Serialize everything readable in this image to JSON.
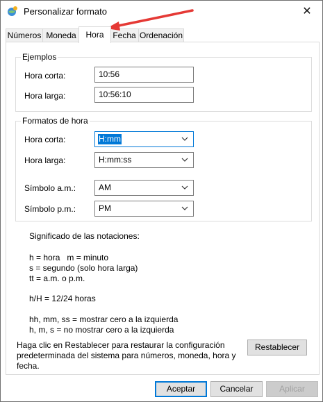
{
  "window": {
    "title": "Personalizar formato",
    "close_glyph": "✕"
  },
  "tabs": [
    {
      "label": "Números",
      "active": false
    },
    {
      "label": "Moneda",
      "active": false
    },
    {
      "label": "Hora",
      "active": true
    },
    {
      "label": "Fecha",
      "active": false
    },
    {
      "label": "Ordenación",
      "active": false
    }
  ],
  "ejemplos": {
    "title": "Ejemplos",
    "hora_corta_label": "Hora corta:",
    "hora_corta_value": "10:56",
    "hora_larga_label": "Hora larga:",
    "hora_larga_value": "10:56:10"
  },
  "formatos": {
    "title": "Formatos de hora",
    "hora_corta_label": "Hora corta:",
    "hora_corta_value": "H:mm",
    "hora_larga_label": "Hora larga:",
    "hora_larga_value": "H:mm:ss",
    "am_label": "Símbolo a.m.:",
    "am_value": "AM",
    "pm_label": "Símbolo p.m.:",
    "pm_value": "PM"
  },
  "notaciones": {
    "title": "Significado de las notaciones:",
    "line1": "h = hora   m = minuto",
    "line2": "s = segundo (solo hora larga)",
    "line3": "tt = a.m. o p.m.",
    "line4": "h/H = 12/24 horas",
    "line5": "hh, mm, ss = mostrar cero a la izquierda",
    "line6": "h, m, s = no mostrar cero a la izquierda"
  },
  "restablecer": {
    "text_line1": "Haga clic en Restablecer para restaurar la configuración",
    "text_line2": "predeterminada del sistema para números, moneda, hora y",
    "text_line3": "fecha.",
    "button": "Restablecer"
  },
  "footer": {
    "accept": "Aceptar",
    "cancel": "Cancelar",
    "apply": "Aplicar"
  },
  "colors": {
    "accent": "#0078d7",
    "annotation_arrow": "#e53935"
  }
}
